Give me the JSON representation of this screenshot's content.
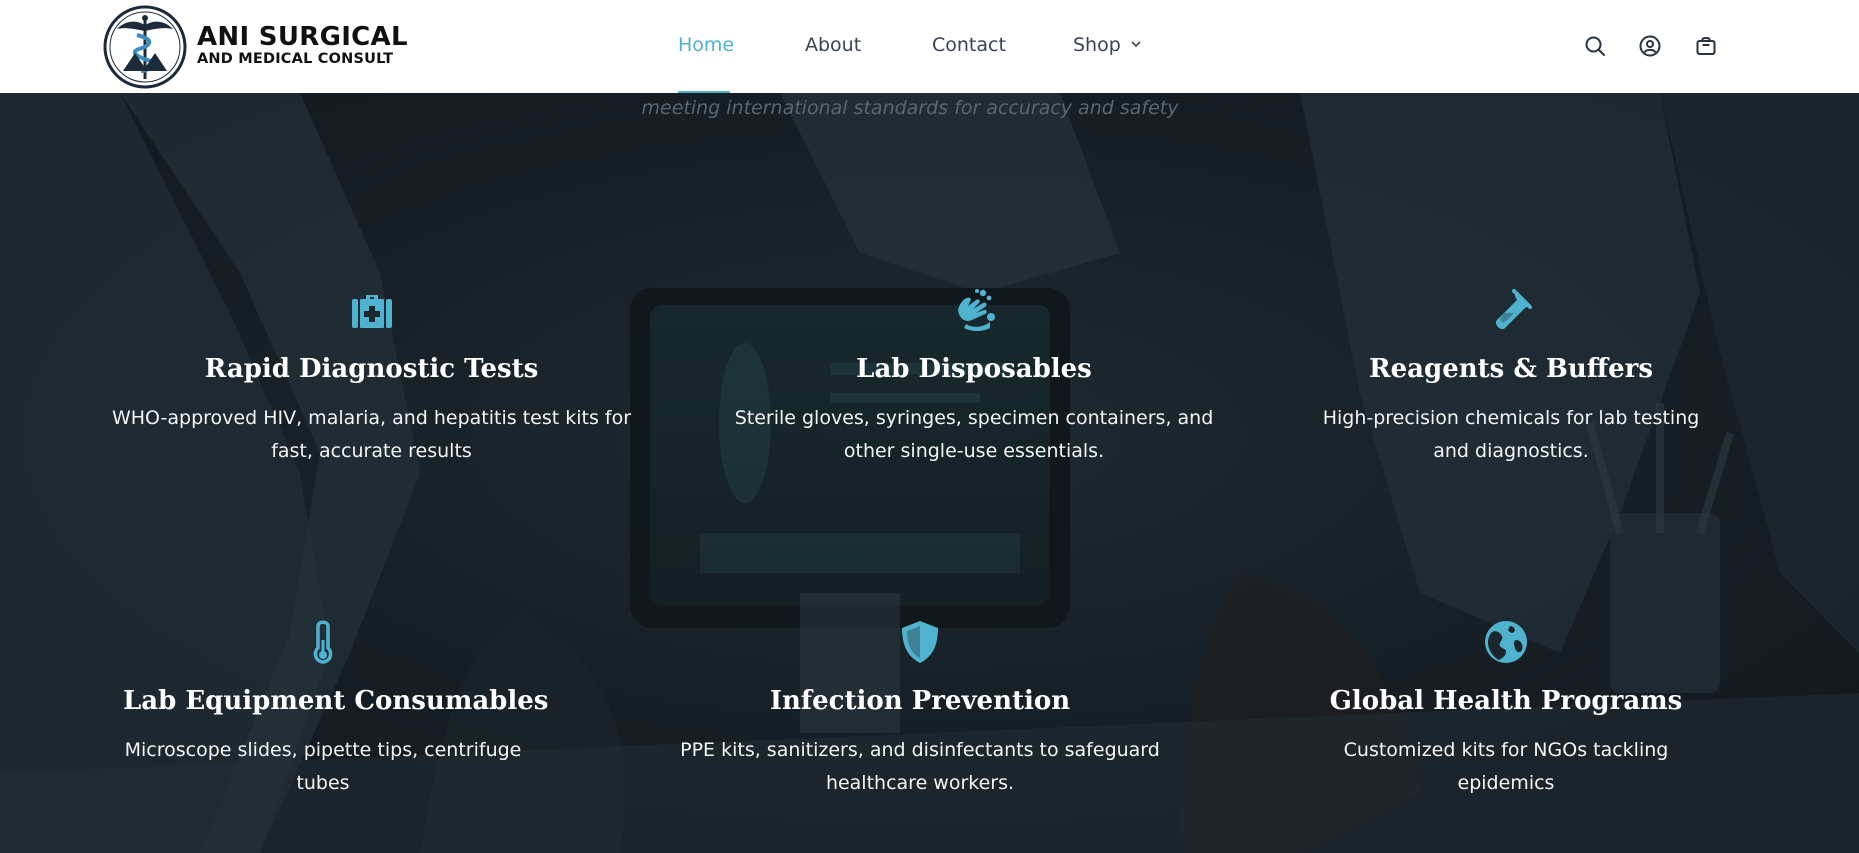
{
  "brand": {
    "name_line1": "ANI SURGICAL",
    "name_line2": "AND MEDICAL CONSULT",
    "logo_icon": "caduceus-logo"
  },
  "nav": {
    "items": [
      {
        "label": "Home",
        "active": true
      },
      {
        "label": "About",
        "active": false
      },
      {
        "label": "Contact",
        "active": false
      },
      {
        "label": "Shop",
        "active": false,
        "has_dropdown": true
      }
    ]
  },
  "header_icons": [
    "search-icon",
    "account-icon",
    "cart-icon"
  ],
  "hero": {
    "tagline": "meeting international standards for accuracy and safety"
  },
  "features": [
    {
      "icon": "medical-kit-icon",
      "title": "Rapid Diagnostic Tests",
      "desc": "WHO-approved HIV, malaria, and hepatitis test kits for fast, accurate results"
    },
    {
      "icon": "hand-washing-icon",
      "title": "Lab Disposables",
      "desc": "Sterile gloves, syringes, specimen containers, and other single-use essentials."
    },
    {
      "icon": "test-tube-icon",
      "title": "Reagents & Buffers",
      "desc": "High-precision chemicals for lab testing and diagnostics."
    },
    {
      "icon": "thermometer-icon",
      "title": "Lab Equipment Consumables",
      "desc": "Microscope slides, pipette tips, centrifuge tubes"
    },
    {
      "icon": "shield-icon",
      "title": "Infection Prevention",
      "desc": "PPE kits, sanitizers, and disinfectants to safeguard healthcare workers."
    },
    {
      "icon": "globe-icon",
      "title": "Global Health Programs",
      "desc": "Customized kits for NGOs tackling epidemics"
    }
  ],
  "colors": {
    "accent": "#4fb3cf",
    "header_bg": "#ffffff",
    "hero_bg": "#1b252c",
    "text_light": "#ffffff"
  }
}
